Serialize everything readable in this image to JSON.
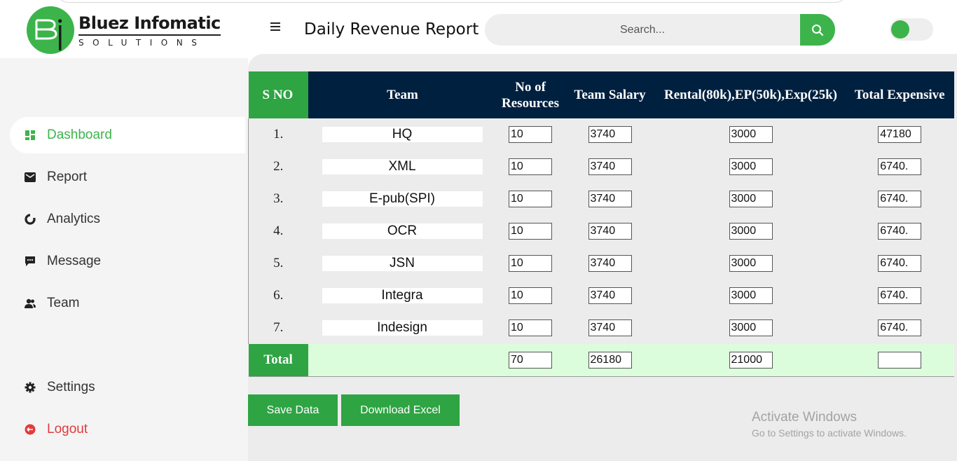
{
  "brand": {
    "name": "Bluez Infomatic",
    "sub": "SOLUTIONS"
  },
  "header": {
    "title": "Daily Revenue Report",
    "search_placeholder": "Search..."
  },
  "sidebar": {
    "items": [
      {
        "label": "Dashboard",
        "icon": "dashboard-icon"
      },
      {
        "label": "Report",
        "icon": "envelope-icon"
      },
      {
        "label": "Analytics",
        "icon": "pie-chart-icon"
      },
      {
        "label": "Message",
        "icon": "chat-icon"
      },
      {
        "label": "Team",
        "icon": "users-icon"
      },
      {
        "label": "Settings",
        "icon": "gear-icon"
      },
      {
        "label": "Logout",
        "icon": "logout-icon"
      }
    ]
  },
  "table": {
    "headers": {
      "sno": "S NO",
      "team": "Team",
      "resources": "No of Resources",
      "salary": "Team Salary",
      "rental": "Rental(80k),EP(50k),Exp(25k)",
      "total": "Total Expensive"
    },
    "rows": [
      {
        "sno": "1.",
        "team": "HQ",
        "resources": "10",
        "salary": "3740",
        "rental": "3000",
        "total": "47180"
      },
      {
        "sno": "2.",
        "team": "XML",
        "resources": "10",
        "salary": "3740",
        "rental": "3000",
        "total": "6740."
      },
      {
        "sno": "3.",
        "team": "E-pub(SPI)",
        "resources": "10",
        "salary": "3740",
        "rental": "3000",
        "total": "6740."
      },
      {
        "sno": "4.",
        "team": "OCR",
        "resources": "10",
        "salary": "3740",
        "rental": "3000",
        "total": "6740."
      },
      {
        "sno": "5.",
        "team": "JSN",
        "resources": "10",
        "salary": "3740",
        "rental": "3000",
        "total": "6740."
      },
      {
        "sno": "6.",
        "team": "Integra",
        "resources": "10",
        "salary": "3740",
        "rental": "3000",
        "total": "6740."
      },
      {
        "sno": "7.",
        "team": "Indesign",
        "resources": "10",
        "salary": "3740",
        "rental": "3000",
        "total": "6740."
      }
    ],
    "total": {
      "label": "Total",
      "resources": "70",
      "salary": "26180",
      "rental": "21000",
      "total": ""
    }
  },
  "actions": {
    "save": "Save Data",
    "download": "Download Excel"
  },
  "watermark": {
    "title": "Activate Windows",
    "sub": "Go to Settings to activate Windows."
  },
  "colors": {
    "accent": "#3cb44b",
    "header_bg": "#00203f",
    "total_row": "#dcfddc",
    "logout": "#e23b3b"
  }
}
